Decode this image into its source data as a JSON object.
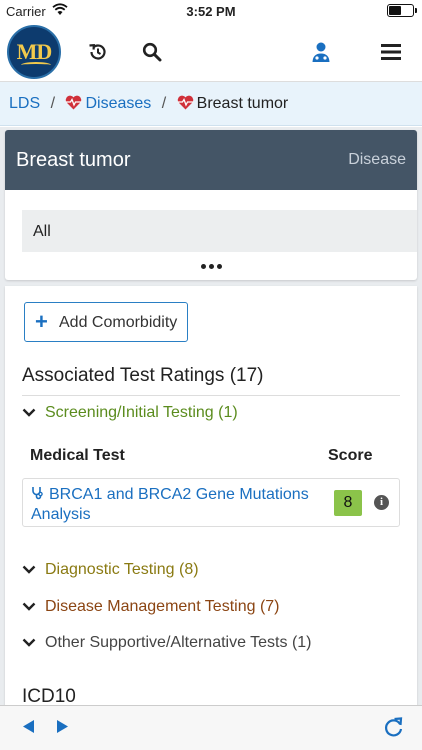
{
  "status_bar": {
    "carrier": "Carrier",
    "time": "3:52 PM"
  },
  "nav": {
    "logo_text": "MD",
    "icons": [
      "history-icon",
      "search-icon",
      "doctor-icon",
      "menu-icon"
    ]
  },
  "breadcrumb": {
    "root": "LDS",
    "section": "Diseases",
    "current": "Breast tumor"
  },
  "disease_card": {
    "title": "Breast tumor",
    "kind": "Disease",
    "filter_value": "All"
  },
  "main": {
    "add_button_label": "Add Comorbidity",
    "ratings_title": "Associated Test Ratings (17)",
    "groups": [
      {
        "label": "Screening/Initial Testing (1)",
        "color": "#5b8c1e"
      },
      {
        "label": "Diagnostic Testing (8)",
        "color": "#8a7a12"
      },
      {
        "label": "Disease Management Testing (7)",
        "color": "#8b4513"
      },
      {
        "label": "Other Supportive/Alternative Tests (1)",
        "color": "#444444"
      }
    ],
    "table": {
      "col_test": "Medical Test",
      "col_score": "Score",
      "rows": [
        {
          "name": "BRCA1 and BRCA2 Gene Mutations Analysis",
          "score": "8"
        }
      ]
    },
    "icd_title": "ICD10"
  },
  "colors": {
    "header_bg": "#445566",
    "link": "#1a6fc0",
    "score_badge": "#8bc34a",
    "breadcrumb_bg": "#e8f3fb",
    "heart": "#d0303a"
  },
  "toolbar": {
    "icons": [
      "back-arrow-icon",
      "forward-arrow-icon",
      "refresh-icon"
    ]
  }
}
